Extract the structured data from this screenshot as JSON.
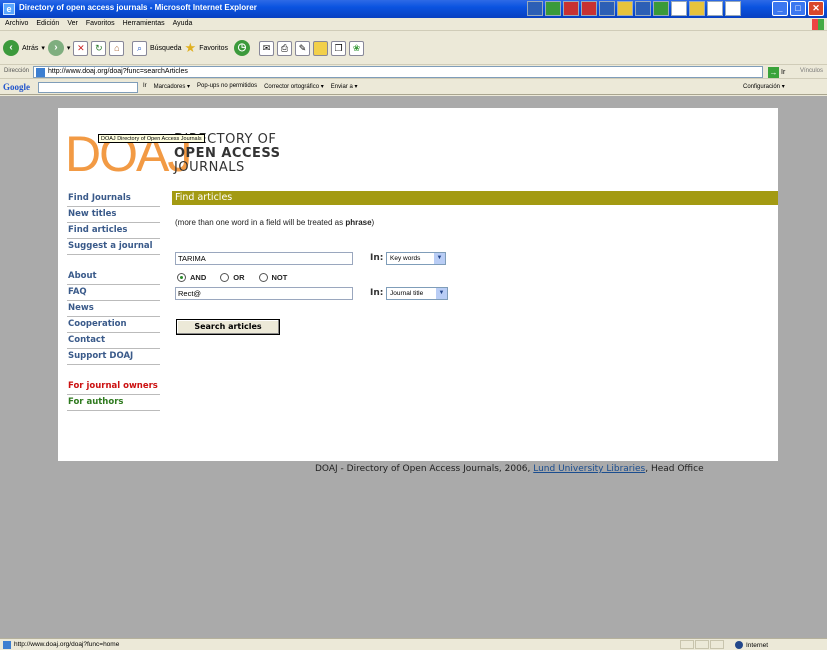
{
  "window": {
    "title": "Directory of open access journals - Microsoft Internet Explorer",
    "minimize": "_",
    "maximize": "□",
    "close": "✕"
  },
  "menubar": {
    "items": [
      "Archivo",
      "Edición",
      "Ver",
      "Favoritos",
      "Herramientas",
      "Ayuda"
    ]
  },
  "toolbar": {
    "back_label": "Atrás",
    "search_label": "Búsqueda",
    "favorites_label": "Favoritos"
  },
  "addressbar": {
    "label": "Dirección",
    "url": "http://www.doaj.org/doaj?func=searchArticles",
    "go_label": "Ir",
    "links_label": "Vínculos"
  },
  "googlebar": {
    "logo": "Google",
    "go_label": "Ir",
    "items": [
      "Marcadores ▾",
      "Pop-ups no permitidos",
      "Corrector ortográfico ▾",
      "Enviar a ▾"
    ],
    "settings_label": "Configuración ▾"
  },
  "logo": {
    "letters": "DOAJ",
    "line1": "DIRECTORY OF",
    "line2": "OPEN ACCESS",
    "line3": "JOURNALS",
    "tooltip": "DOAJ Directory of Open Access Journals"
  },
  "sidebar": {
    "items": [
      "Find Journals",
      "New titles",
      "Find articles",
      "Suggest a journal",
      "About",
      "FAQ",
      "News",
      "Cooperation",
      "Contact",
      "Support DOAJ",
      "For journal owners",
      "For authors"
    ]
  },
  "main": {
    "heading": "Find articles",
    "note_before": "(more than one word in a field will be treated as ",
    "note_bold": "phrase",
    "note_after": ")",
    "field1_value": "TARIMA",
    "field2_value": "Rect@",
    "in_label": "In:",
    "select1_value": "Key words",
    "select2_value": "Journal title",
    "operators": [
      "AND",
      "OR",
      "NOT"
    ],
    "search_button": "Search articles"
  },
  "footer": {
    "text_before": "DOAJ - Directory of Open Access Journals, 2006, ",
    "link": "Lund University Libraries",
    "text_after": ", Head Office"
  },
  "statusbar": {
    "url": "http://www.doaj.org/doaj?func=home",
    "zone": "Internet"
  }
}
